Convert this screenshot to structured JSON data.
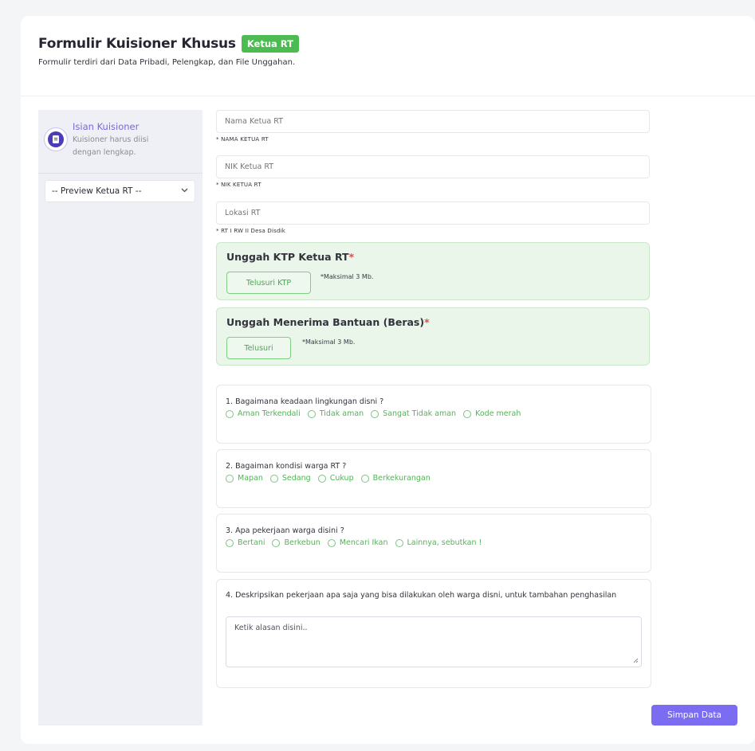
{
  "header": {
    "title": "Formulir Kuisioner Khusus",
    "badge": "Ketua RT",
    "subtitle": "Formulir terdiri dari Data Pribadi, Pelengkap, dan File Unggahan."
  },
  "sidebar": {
    "title": "Isian Kuisioner",
    "description": "Kuisioner harus diisi dengan lengkap.",
    "select_value": "-- Preview Ketua RT --"
  },
  "fields": [
    {
      "placeholder": "Nama Ketua RT",
      "label": "* NAMA KETUA RT"
    },
    {
      "placeholder": "NIK Ketua RT",
      "label": "* NIK KETUA RT"
    },
    {
      "placeholder": "Lokasi RT",
      "label": "* RT I RW II Desa Disdik"
    }
  ],
  "uploads": [
    {
      "title": "Unggah KTP Ketua RT",
      "required_mark": "*",
      "button": "Telusuri KTP",
      "note": "*Maksimal 3 Mb."
    },
    {
      "title": "Unggah Menerima Bantuan (Beras)",
      "required_mark": "*",
      "button": "Telusuri",
      "note": "*Maksimal 3 Mb."
    }
  ],
  "questions": [
    {
      "text": "1. Bagaimana keadaan lingkungan disni ?",
      "options": [
        "Aman Terkendali",
        "Tidak aman",
        "Sangat Tidak aman",
        "Kode merah"
      ]
    },
    {
      "text": "2. Bagaiman kondisi warga RT ?",
      "options": [
        "Mapan",
        "Sedang",
        "Cukup",
        "Berkekurangan"
      ]
    },
    {
      "text": "3. Apa pekerjaan warga disini ?",
      "options": [
        "Bertani",
        "Berkebun",
        "Mencari Ikan",
        "Lainnya, sebutkan !"
      ]
    },
    {
      "text": "4. Deskripsikan pekerjaan apa saja yang bisa dilakukan oleh warga disni, untuk tambahan penghasilan",
      "placeholder": "Ketik alasan disini.."
    }
  ],
  "save_button": "Simpan Data",
  "colors": {
    "accent": "#7c6cf2",
    "badge_green": "#4cbb52",
    "option_green": "#52b457",
    "upload_bg": "#e9f6e9",
    "required_red": "#e14b4b"
  },
  "icons": {
    "sidebar_icon": "document-icon",
    "select_chevron": "chevron-down-icon",
    "radio": "radio-icon"
  }
}
